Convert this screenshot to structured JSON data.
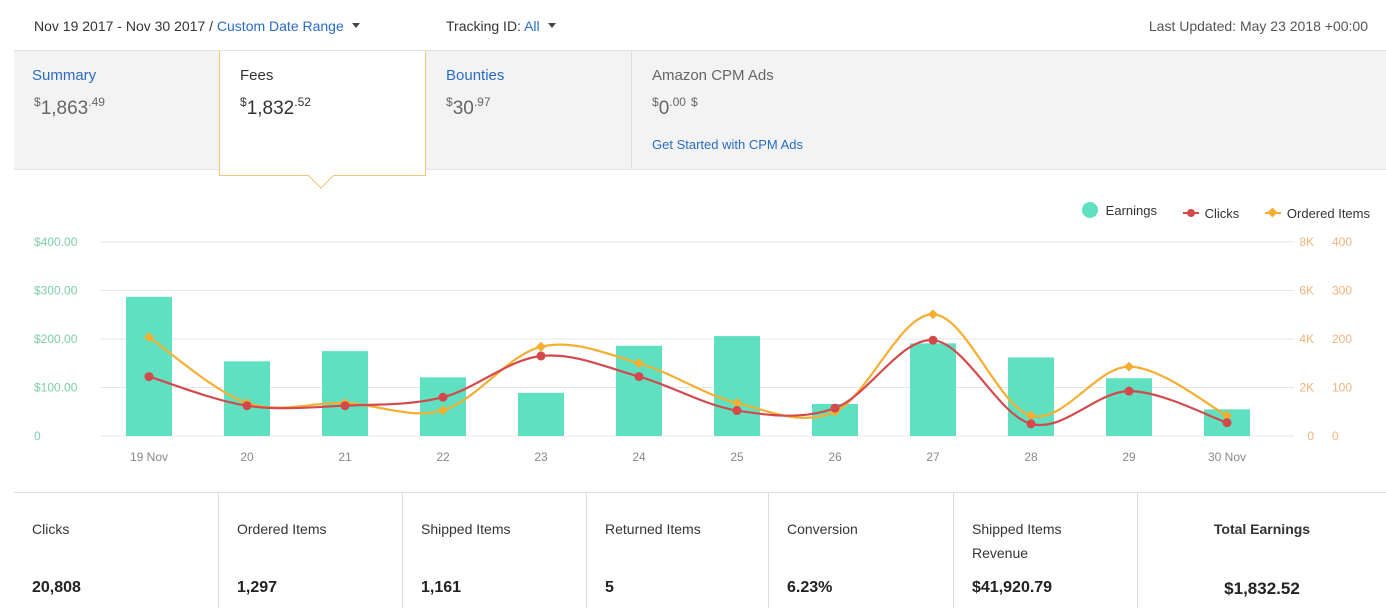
{
  "header": {
    "date_range": "Nov 19 2017 - Nov 30 2017 /",
    "custom_range_link": "Custom Date Range",
    "tracking_label": "Tracking ID:",
    "tracking_value": "All",
    "last_updated": "Last Updated: May 23 2018 +00:00"
  },
  "tabs": {
    "summary": {
      "label": "Summary",
      "currency": "$",
      "whole": "1,863",
      "cents": ".49"
    },
    "fees": {
      "label": "Fees",
      "currency": "$",
      "whole": "1,832",
      "cents": ".52"
    },
    "bounties": {
      "label": "Bounties",
      "currency": "$",
      "whole": "30",
      "cents": ".97"
    },
    "cpm": {
      "label": "Amazon CPM Ads",
      "currency": "$",
      "whole": "0",
      "cents": ".00",
      "suffix": "$",
      "link": "Get Started with CPM Ads"
    }
  },
  "legend": {
    "earnings": "Earnings",
    "clicks": "Clicks",
    "ordered": "Ordered Items"
  },
  "colors": {
    "earnings": "#5fe0c1",
    "clicks": "#d3494c",
    "ordered": "#f5ae2f",
    "link": "#2a6cc4",
    "left_axis": "#7dcfa8",
    "right_axis": "#f2b27a"
  },
  "chart_data": {
    "type": "bar",
    "categories": [
      "19 Nov",
      "20",
      "21",
      "22",
      "23",
      "24",
      "25",
      "26",
      "27",
      "28",
      "29",
      "30 Nov"
    ],
    "series": [
      {
        "name": "Earnings",
        "type": "bar",
        "axis": "left",
        "values": [
          287,
          154,
          175,
          121,
          89,
          186,
          206,
          66,
          191,
          162,
          119,
          55
        ]
      },
      {
        "name": "Clicks",
        "type": "line",
        "axis": "right-1",
        "values": [
          2450,
          1250,
          1250,
          1600,
          3300,
          2450,
          1050,
          1150,
          3950,
          500,
          1850,
          550
        ]
      },
      {
        "name": "Ordered Items",
        "type": "line",
        "axis": "right-2",
        "values": [
          204,
          68,
          68,
          53,
          184,
          150,
          68,
          50,
          251,
          42,
          143,
          42
        ]
      }
    ],
    "y_left": {
      "ticks": [
        "$400.00",
        "$300.00",
        "$200.00",
        "$100.00",
        "0"
      ],
      "ylim": [
        0,
        400
      ]
    },
    "y_right_1": {
      "ticks": [
        "8K",
        "6K",
        "4K",
        "2K",
        "0"
      ],
      "ylim": [
        0,
        8000
      ]
    },
    "y_right_2": {
      "ticks": [
        "400",
        "300",
        "200",
        "100",
        "0"
      ],
      "ylim": [
        0,
        400
      ]
    },
    "grid": true,
    "legend_position": "top-right"
  },
  "stats": [
    {
      "label": "Clicks",
      "value": "20,808"
    },
    {
      "label": "Ordered Items",
      "value": "1,297"
    },
    {
      "label": "Shipped Items",
      "value": "1,161"
    },
    {
      "label": "Returned Items",
      "value": "5"
    },
    {
      "label": "Conversion",
      "value": "6.23%"
    },
    {
      "label": "Shipped Items Revenue",
      "value": "$41,920.79"
    },
    {
      "label": "Total Earnings",
      "value": "$1,832.52"
    }
  ]
}
